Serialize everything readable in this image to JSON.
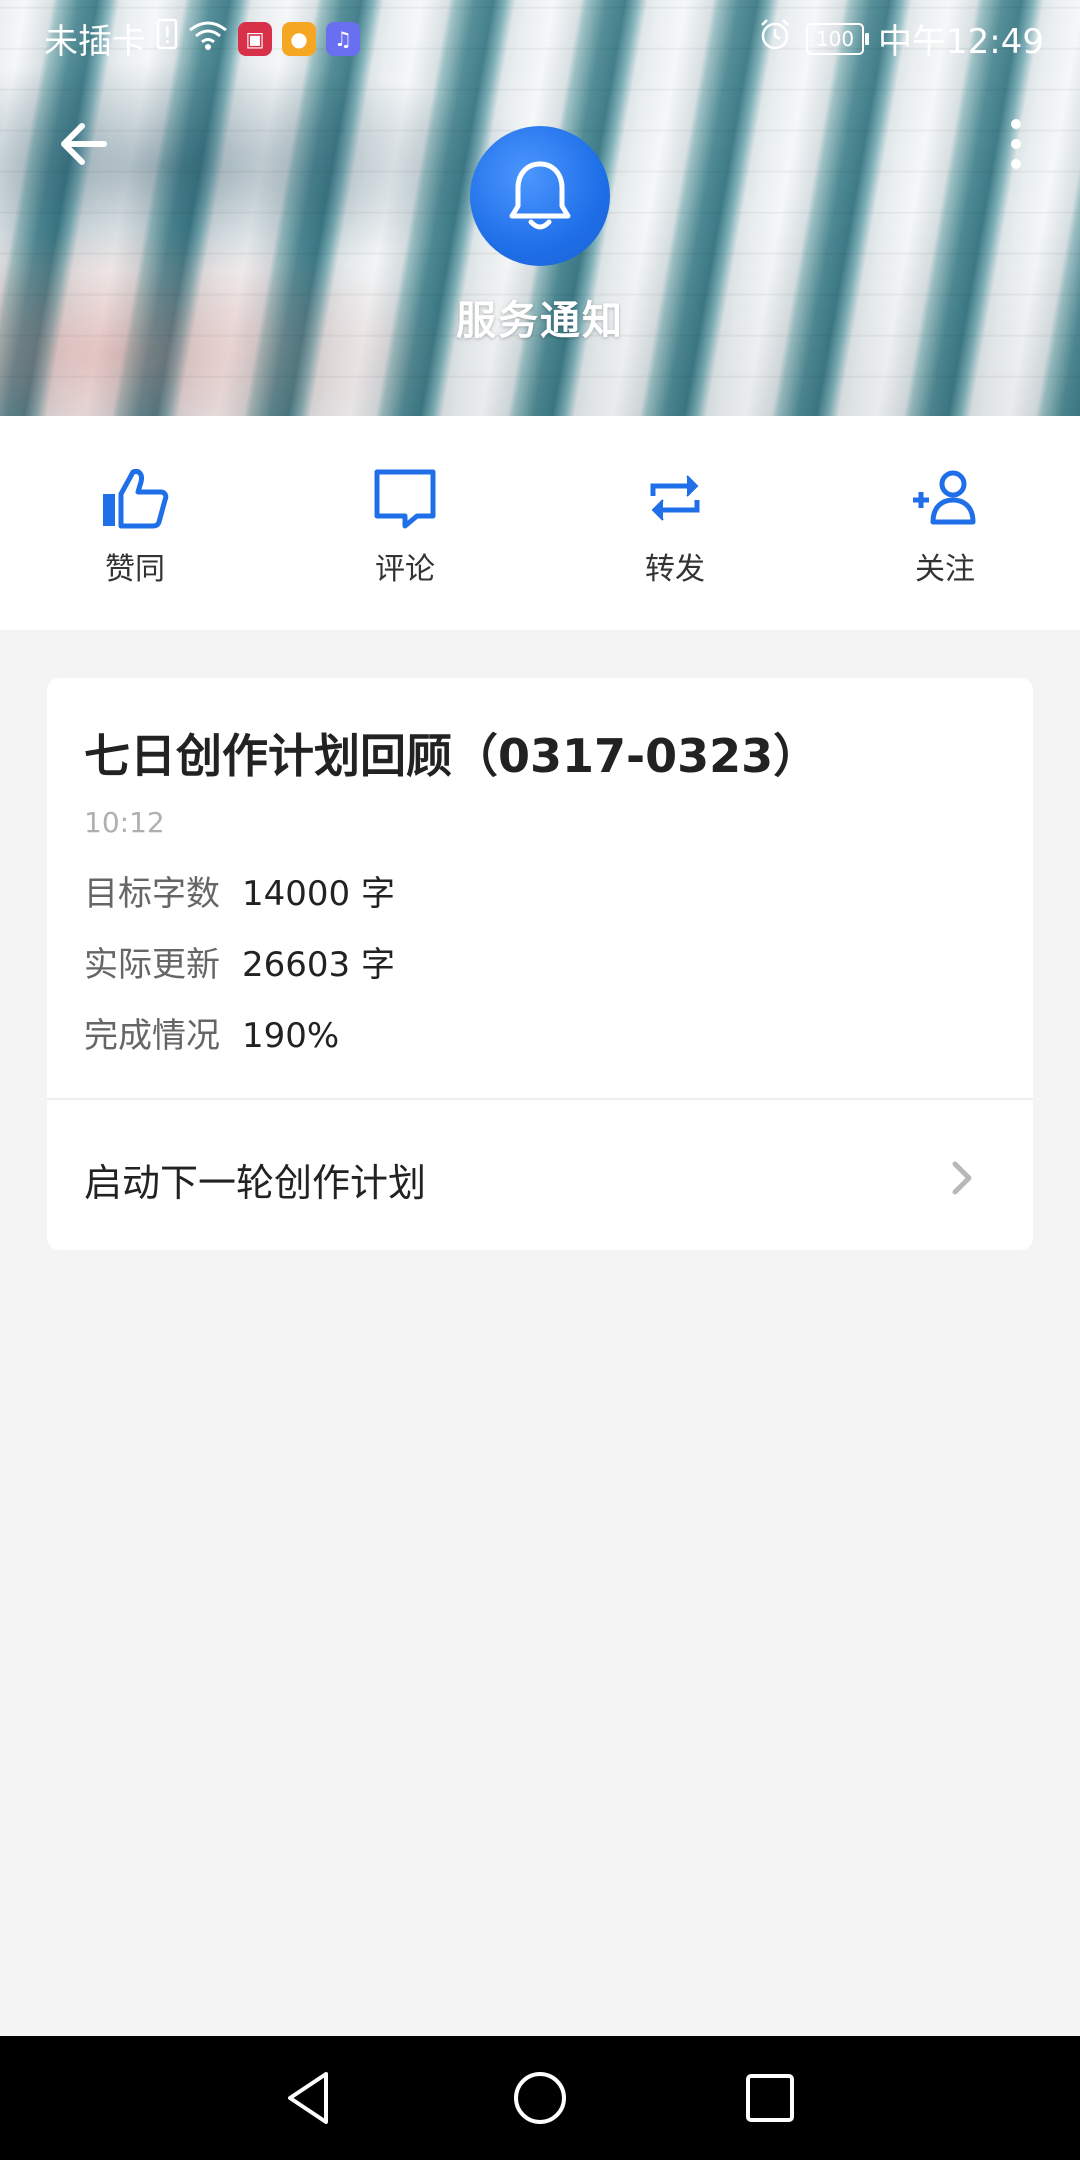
{
  "status_bar": {
    "carrier": "未插卡",
    "battery": "100",
    "time": "中午12:49"
  },
  "header": {
    "title": "服务通知"
  },
  "actions": [
    {
      "label": "赞同",
      "icon": "thumbs-up-icon"
    },
    {
      "label": "评论",
      "icon": "comment-icon"
    },
    {
      "label": "转发",
      "icon": "repost-icon"
    },
    {
      "label": "关注",
      "icon": "add-follow-icon"
    }
  ],
  "card": {
    "title": "七日创作计划回顾（0317-0323）",
    "time": "10:12",
    "stats": [
      {
        "label": "目标字数",
        "value": "14000 字"
      },
      {
        "label": "实际更新",
        "value": "26603 字"
      },
      {
        "label": "完成情况",
        "value": "190%"
      }
    ],
    "next_action": "启动下一轮创作计划"
  },
  "colors": {
    "accent": "#1f6fe8",
    "background": "#f4f4f4"
  }
}
